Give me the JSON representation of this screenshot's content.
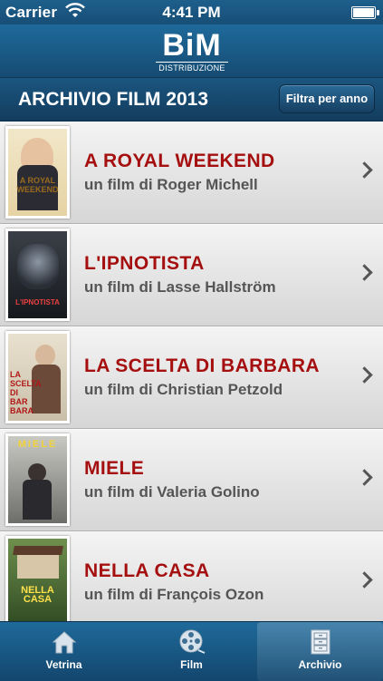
{
  "status_bar": {
    "carrier": "Carrier",
    "time": "4:41 PM",
    "battery": 1.0
  },
  "brand": {
    "logo_main": "BiM",
    "logo_sub": "DISTRIBUZIONE"
  },
  "header": {
    "title": "ARCHIVIO FILM 2013",
    "filter_label": "Filtra per anno"
  },
  "films": [
    {
      "title": "A ROYAL WEEKEND",
      "subtitle": "un film di Roger Michell",
      "poster_text": "A ROYAL WEEKEND"
    },
    {
      "title": "L'IPNOTISTA",
      "subtitle": "un film di Lasse Hallström",
      "poster_text": "L'IPNOTISTA"
    },
    {
      "title": "LA SCELTA DI BARBARA",
      "subtitle": "un film di Christian Petzold",
      "poster_text": "LA SCELTA DI BAR BARA"
    },
    {
      "title": "MIELE",
      "subtitle": "un film di Valeria Golino",
      "poster_text": "MIELE"
    },
    {
      "title": "NELLA CASA",
      "subtitle": "un film di François Ozon",
      "poster_text": "NELLA CASA"
    }
  ],
  "tabs": [
    {
      "label": "Vetrina",
      "icon": "house-icon"
    },
    {
      "label": "Film",
      "icon": "film-reel-icon"
    },
    {
      "label": "Archivio",
      "icon": "cabinet-icon",
      "active": true
    }
  ],
  "colors": {
    "accent_title": "#a50f0f",
    "bar_blue": "#1f6a9b"
  }
}
